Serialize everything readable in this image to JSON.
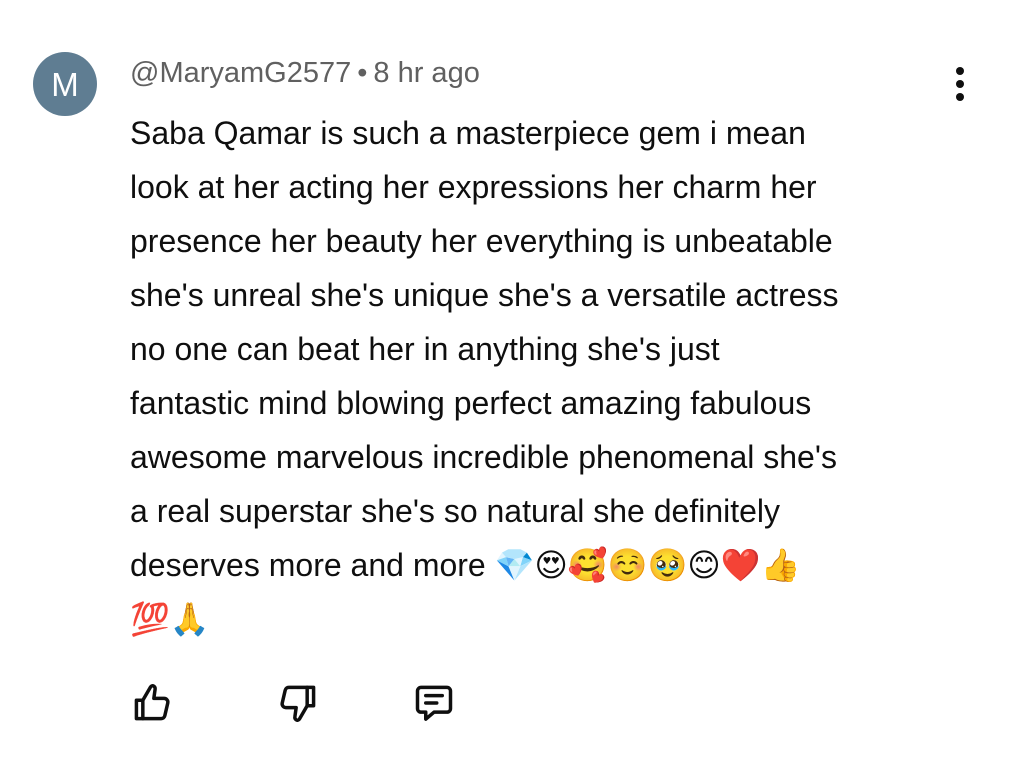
{
  "author": {
    "avatar_initial": "M",
    "avatar_color": "#5f7d92",
    "handle": "@MaryamG2577",
    "separator": "•",
    "time": "8 hr ago"
  },
  "comment": {
    "lines": [
      "Saba Qamar is such a masterpiece gem i mean",
      "look at her acting her expressions her charm her",
      "presence her beauty her everything is unbeatable",
      "she's unreal she's unique she's a versatile actress",
      "no one can beat her in anything she's just",
      "fantastic mind blowing perfect amazing fabulous",
      "awesome marvelous incredible phenomenal she's",
      "a real superstar she's so natural she definitely",
      "deserves more and more"
    ],
    "emojis_line9": "💎😍🥰☺️🥹😊❤️👍",
    "emojis_line10": "💯🙏"
  },
  "actions": {
    "like": "thumbs-up-icon",
    "dislike": "thumbs-down-icon",
    "reply": "reply-comment-icon"
  },
  "menu": {
    "icon": "more-vert-icon"
  }
}
